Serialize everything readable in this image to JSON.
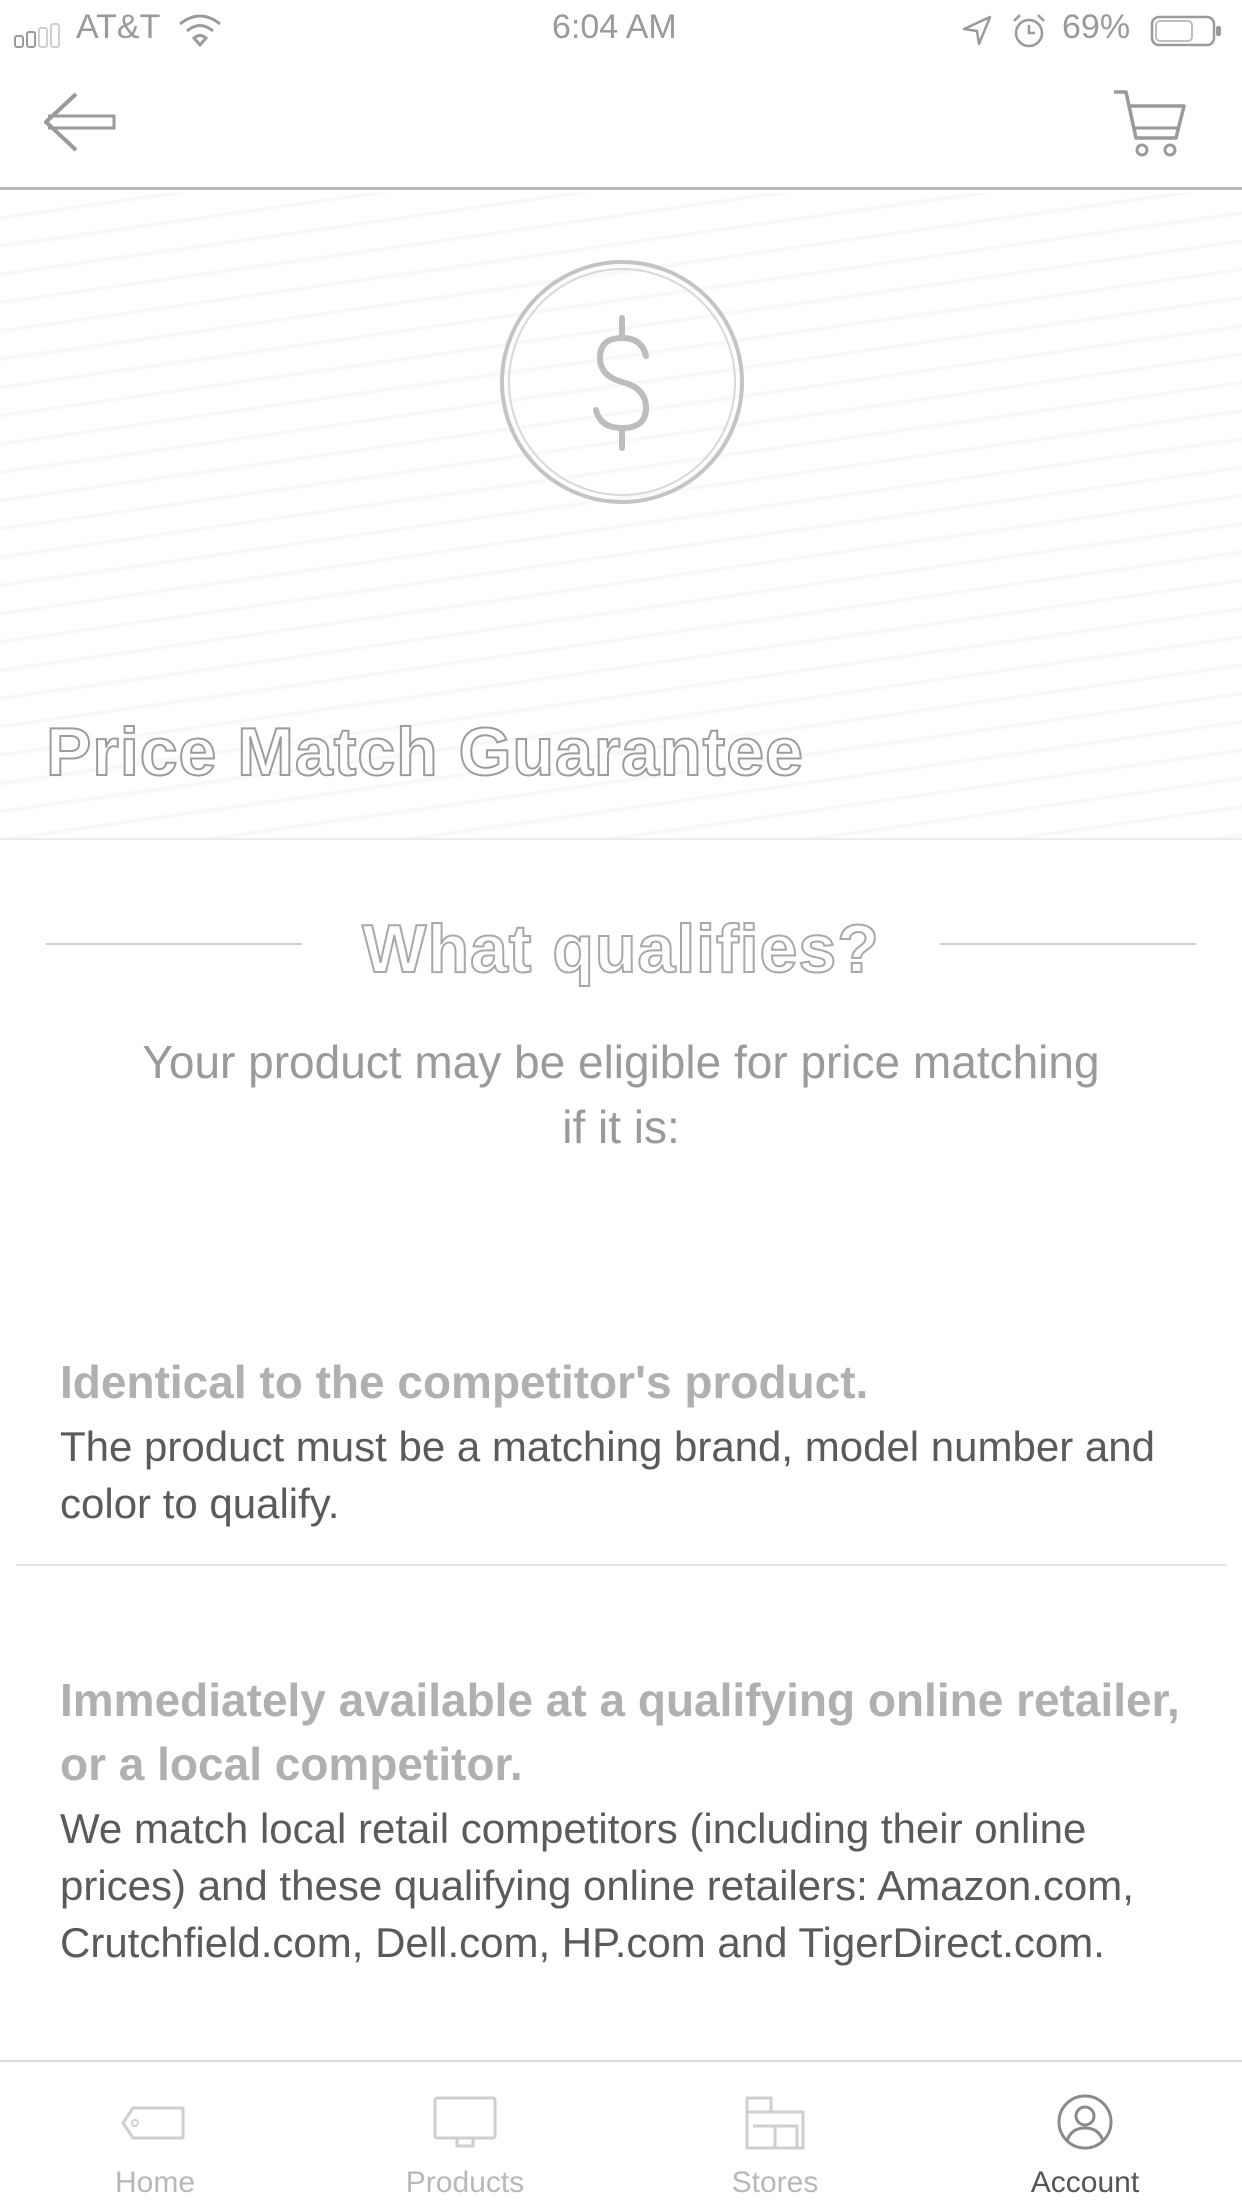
{
  "status_bar": {
    "carrier": "AT&T",
    "time": "6:04 AM",
    "battery": "69%"
  },
  "nav": {
    "back_icon": "arrow-left-icon",
    "cart_icon": "shopping-cart-icon"
  },
  "hero": {
    "icon": "dollar-circle-icon",
    "title": "Price Match Guarantee"
  },
  "section": {
    "title": "What qualifies?",
    "intro": "Your product may be eligible for price matching if it is:"
  },
  "qualifications": [
    {
      "heading": "Identical to the competitor's product.",
      "body": "The product must be a matching brand, model number and color to qualify."
    },
    {
      "heading": "Immediately available at a qualifying online retailer, or a local competitor.",
      "body": "We match local retail competitors (including their online prices) and these qualifying online retailers: Amazon.com, Crutchfield.com, Dell.com, HP.com and TigerDirect.com."
    }
  ],
  "tabs": [
    {
      "label": "Home",
      "icon": "tag-icon"
    },
    {
      "label": "Products",
      "icon": "monitor-icon"
    },
    {
      "label": "Stores",
      "icon": "store-icon"
    },
    {
      "label": "Account",
      "icon": "user-circle-icon",
      "active": true
    }
  ]
}
